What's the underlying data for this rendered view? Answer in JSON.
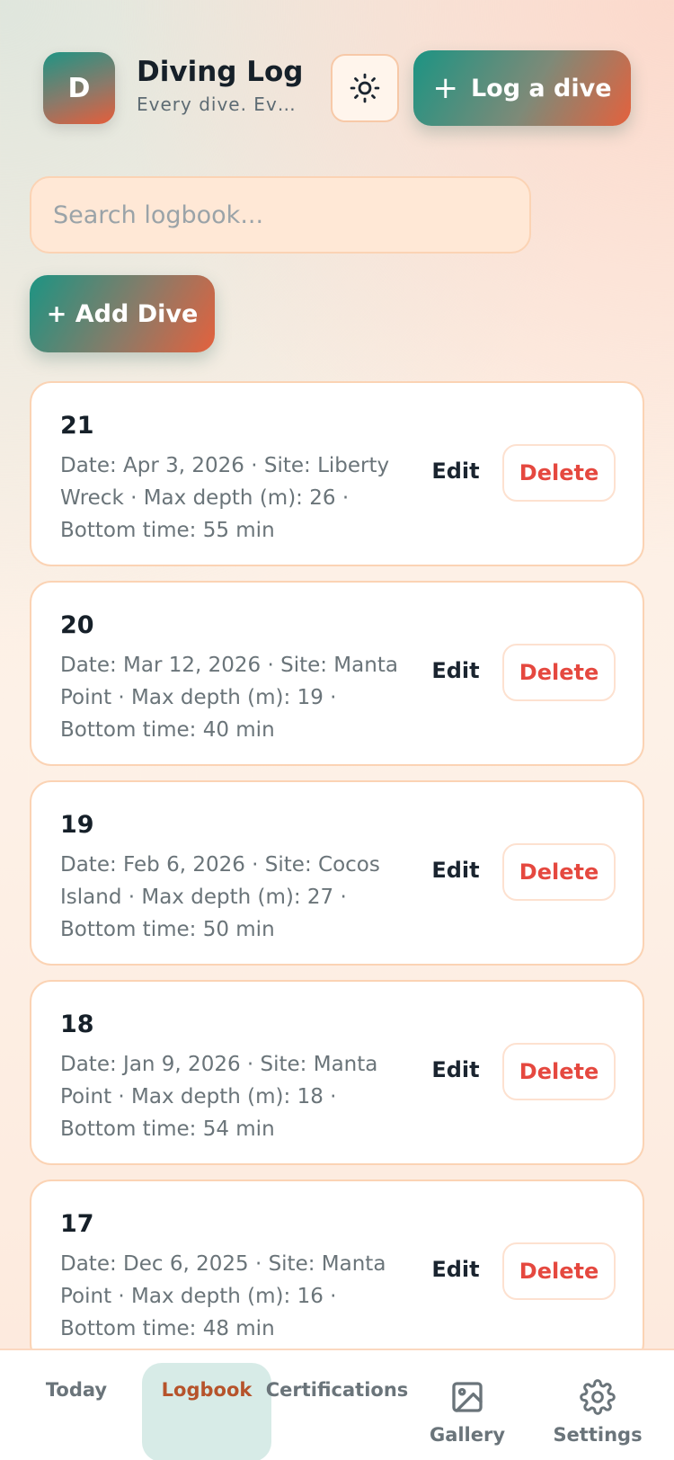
{
  "header": {
    "logo_letter": "D",
    "title": "Diving Log",
    "subtitle": "Every dive. Every detail.",
    "theme_icon": "sun-icon",
    "log_button_label": "Log a dive",
    "log_button_icon": "plus-icon"
  },
  "search": {
    "placeholder": "Search logbook...",
    "value": ""
  },
  "add_button_label": "+ Add Dive",
  "dives": [
    {
      "number": "21",
      "details": "Date: Apr 3, 2026 · Site: Liberty Wreck · Max depth (m): 26 · Bottom time: 55 min",
      "edit_label": "Edit",
      "delete_label": "Delete"
    },
    {
      "number": "20",
      "details": "Date: Mar 12, 2026 · Site: Manta Point · Max depth (m): 19 · Bottom time: 40 min",
      "edit_label": "Edit",
      "delete_label": "Delete"
    },
    {
      "number": "19",
      "details": "Date: Feb 6, 2026 · Site: Cocos Island · Max depth (m): 27 · Bottom time: 50 min",
      "edit_label": "Edit",
      "delete_label": "Delete"
    },
    {
      "number": "18",
      "details": "Date: Jan 9, 2026 · Site: Manta Point · Max depth (m): 18 · Bottom time: 54 min",
      "edit_label": "Edit",
      "delete_label": "Delete"
    },
    {
      "number": "17",
      "details": "Date: Dec 6, 2025 · Site: Manta Point · Max depth (m): 16 · Bottom time: 48 min",
      "edit_label": "Edit",
      "delete_label": "Delete"
    }
  ],
  "tabs": [
    {
      "label": "Today",
      "active": false
    },
    {
      "label": "Logbook",
      "active": true
    },
    {
      "label": "Certifications",
      "active": false
    },
    {
      "label": "Gallery",
      "icon": "image-icon",
      "active": false
    },
    {
      "label": "Settings",
      "icon": "gear-icon",
      "active": false
    }
  ],
  "colors": {
    "accent_teal": "#1c9483",
    "accent_orange": "#e4613d",
    "delete_red": "#e5483f",
    "active_tab_text": "#b6532b",
    "active_tab_bg": "#d7ebe7"
  }
}
